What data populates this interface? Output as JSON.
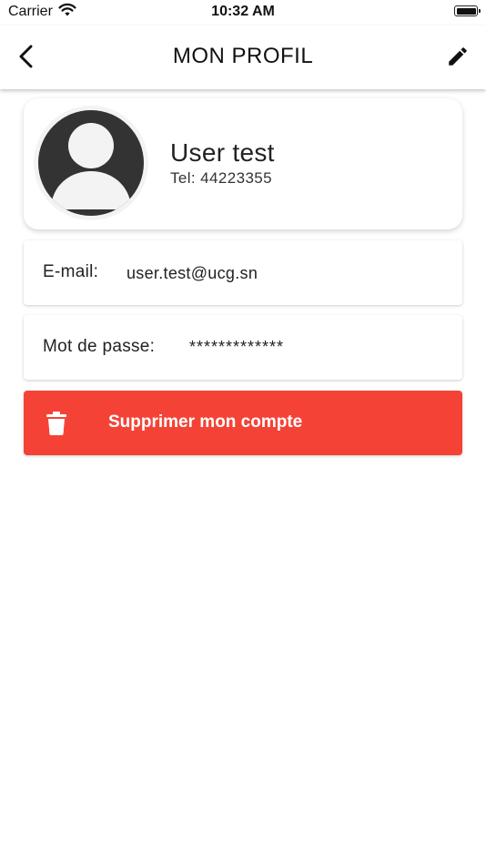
{
  "status_bar": {
    "carrier": "Carrier",
    "time": "10:32 AM",
    "battery_level": 1.0,
    "wifi_icon": "wifi-icon",
    "battery_icon": "battery-icon"
  },
  "app_bar": {
    "title": "MON PROFIL",
    "back_icon": "chevron-left-icon",
    "edit_icon": "pencil-icon"
  },
  "profile": {
    "avatar_icon": "user-avatar-icon",
    "name": "User test",
    "tel": "Tel: 44223355"
  },
  "email": {
    "label": "E-mail:",
    "value": "user.test@ucg.sn"
  },
  "password": {
    "label": "Mot de passe:",
    "value": "*************"
  },
  "delete_account": {
    "label": "Supprimer mon compte",
    "icon": "trash-icon"
  },
  "colors": {
    "danger": "#f44336",
    "avatar_dark": "#333333",
    "avatar_light": "#f3f3f3",
    "text": "#222222"
  }
}
